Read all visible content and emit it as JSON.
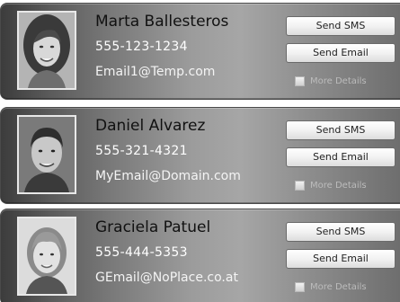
{
  "contacts": [
    {
      "name": "Marta Ballesteros",
      "phone": "555-123-1234",
      "email": "Email1@Temp.com",
      "sms_label": "Send SMS",
      "email_label": "Send Email",
      "details_label": "More Details",
      "details_checked": false
    },
    {
      "name": "Daniel Alvarez",
      "phone": "555-321-4321",
      "email": "MyEmail@Domain.com",
      "sms_label": "Send SMS",
      "email_label": "Send Email",
      "details_label": "More Details",
      "details_checked": false
    },
    {
      "name": "Graciela Patuel",
      "phone": "555-444-5353",
      "email": "GEmail@NoPlace.co.at",
      "sms_label": "Send SMS",
      "email_label": "Send Email",
      "details_label": "More Details",
      "details_checked": false
    }
  ]
}
